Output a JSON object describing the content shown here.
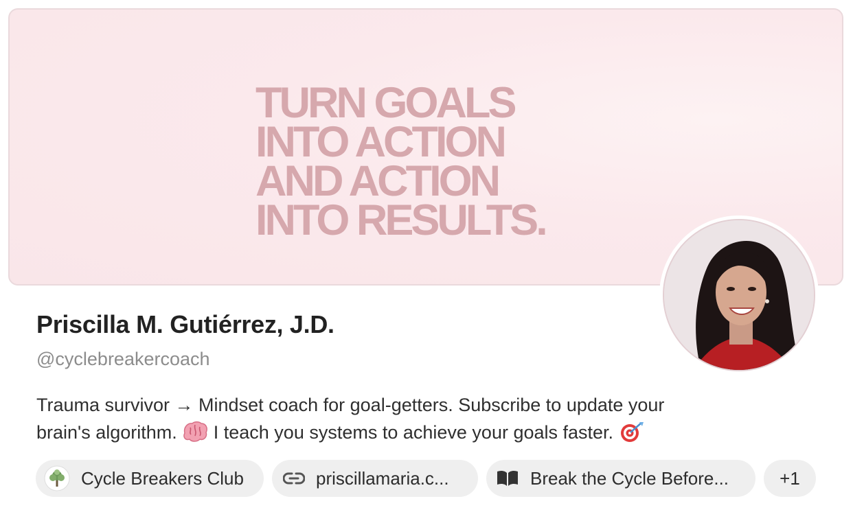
{
  "banner": {
    "headline_lines": [
      "TURN GOALS",
      "INTO ACTION",
      "AND ACTION",
      "INTO RESULTS."
    ]
  },
  "profile": {
    "name": "Priscilla M. Gutiérrez, J.D.",
    "handle": "@cyclebreakercoach",
    "bio_line1_before_arrow": "Trauma survivor ",
    "bio_arrow": "→",
    "bio_line1_after_arrow": " Mindset coach for goal-getters. Subscribe to update your",
    "bio_line2_before_brain": "brain's algorithm. ",
    "bio_line2_after_brain": " I teach you systems to achieve your goals faster. "
  },
  "links": {
    "club_label": "Cycle Breakers Club",
    "website_label": "priscillamaria.c...",
    "book_label": "Break the Cycle Before...",
    "more_label": "+1"
  },
  "icons": {
    "club": "tree-logo-icon",
    "website": "link-icon",
    "book": "open-book-icon",
    "brain": "brain-emoji-icon",
    "target": "bullseye-emoji-icon"
  },
  "colors": {
    "banner_bg": "#f9e6e9",
    "banner_text": "#d6a8ad",
    "chip_bg": "#efefef",
    "name_text": "#222222",
    "handle_text": "#8c8c8c"
  }
}
